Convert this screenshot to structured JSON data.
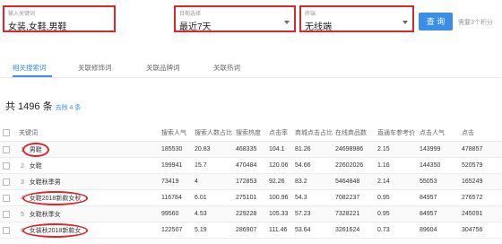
{
  "filters": {
    "keyword": {
      "label": "输入关键词",
      "value": "女装,女鞋,男鞋"
    },
    "date_range": {
      "label": "日期选择",
      "value": "最近7天"
    },
    "terminal": {
      "label": "终端",
      "value": "无线端"
    }
  },
  "query_button": "查 询",
  "cost_note": "需要3个积分",
  "tabs": [
    "相关搜索词",
    "关联修饰词",
    "关联品牌词",
    "关联热词"
  ],
  "active_tab": 0,
  "summary": {
    "prefix": "共 1496 条",
    "remove_link": "去除 4 条"
  },
  "table": {
    "columns": [
      "",
      "关键词",
      "搜索人气",
      "搜索人数占比",
      "搜索热度",
      "点击率",
      "商城点击占比",
      "在线商品数",
      "直通车参考价",
      "点击人气",
      "点击"
    ],
    "rows": [
      {
        "idx": "1",
        "keyword": "男鞋",
        "circled": true,
        "cells": [
          "185530",
          "20.83",
          "468335",
          "104.1",
          "81.26",
          "24698986",
          "2.15",
          "143999",
          "478857"
        ]
      },
      {
        "idx": "2",
        "keyword": "女鞋",
        "circled": false,
        "cells": [
          "199941",
          "15.7",
          "470484",
          "120.06",
          "54.66",
          "22602026",
          "1.16",
          "144350",
          "520579"
        ]
      },
      {
        "idx": "3",
        "keyword": "女鞋秋季男",
        "circled": false,
        "cells": [
          "73419",
          "4",
          "172853",
          "92.26",
          "83.2",
          "5464848",
          "2.14",
          "55053",
          "165249"
        ]
      },
      {
        "idx": "4",
        "keyword": "女鞋2018新款女秋",
        "circled": true,
        "cells": [
          "116784",
          "6.01",
          "275101",
          "100.96",
          "54.3",
          "7082237",
          "0.95",
          "84957",
          "276572"
        ]
      },
      {
        "idx": "5",
        "keyword": "女鞋秋季女",
        "circled": false,
        "cells": [
          "99560",
          "4.53",
          "229228",
          "105.33",
          "57.23",
          "7328221",
          "0.95",
          "84957",
          "245091"
        ]
      },
      {
        "idx": "6",
        "keyword": "女装秋2018新款女",
        "circled": true,
        "cells": [
          "122507",
          "5.19",
          "286907",
          "111.46",
          "53.64",
          "3261624",
          "0.73",
          "89604",
          "304756"
        ]
      }
    ]
  }
}
